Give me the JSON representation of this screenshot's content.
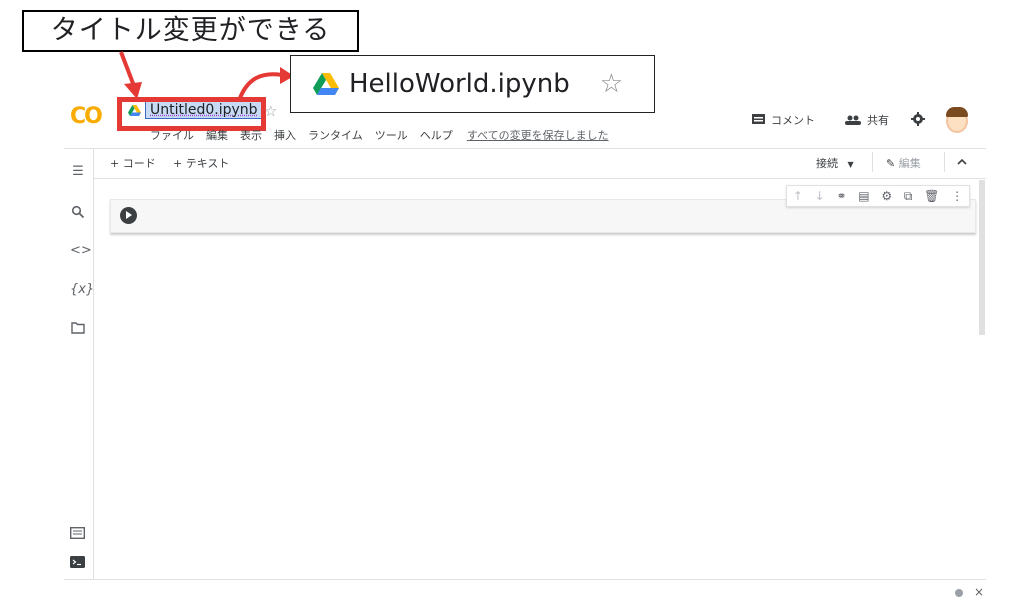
{
  "annotation": {
    "label": "タイトル変更ができる",
    "callout_title": "HelloWorld.ipynb",
    "callout_star": "☆"
  },
  "header": {
    "logo": "CO",
    "title": "Untitled0.ipynb",
    "star": "☆",
    "menu": [
      "ファイル",
      "編集",
      "表示",
      "挿入",
      "ランタイム",
      "ツール",
      "ヘルプ"
    ],
    "saved_status": "すべての変更を保存しました",
    "comment_label": "コメント",
    "share_label": "共有"
  },
  "toolbar": {
    "add_code": "+ コード",
    "add_text": "+ テキスト",
    "connect": "接続",
    "edit": "編集"
  },
  "sidebar": {
    "icons": [
      "toc-icon",
      "search-icon",
      "code-snippets-icon",
      "variables-icon",
      "folder-icon"
    ],
    "variables_text": "{x}",
    "code_text": "<>",
    "bottom_icons": [
      "command-palette-icon",
      "terminal-icon"
    ]
  },
  "footer": {
    "close": "×"
  },
  "colors": {
    "annotation_red": "#e53935",
    "colab_orange": "#f9ab00",
    "selection_blue": "#c8dbf5"
  }
}
